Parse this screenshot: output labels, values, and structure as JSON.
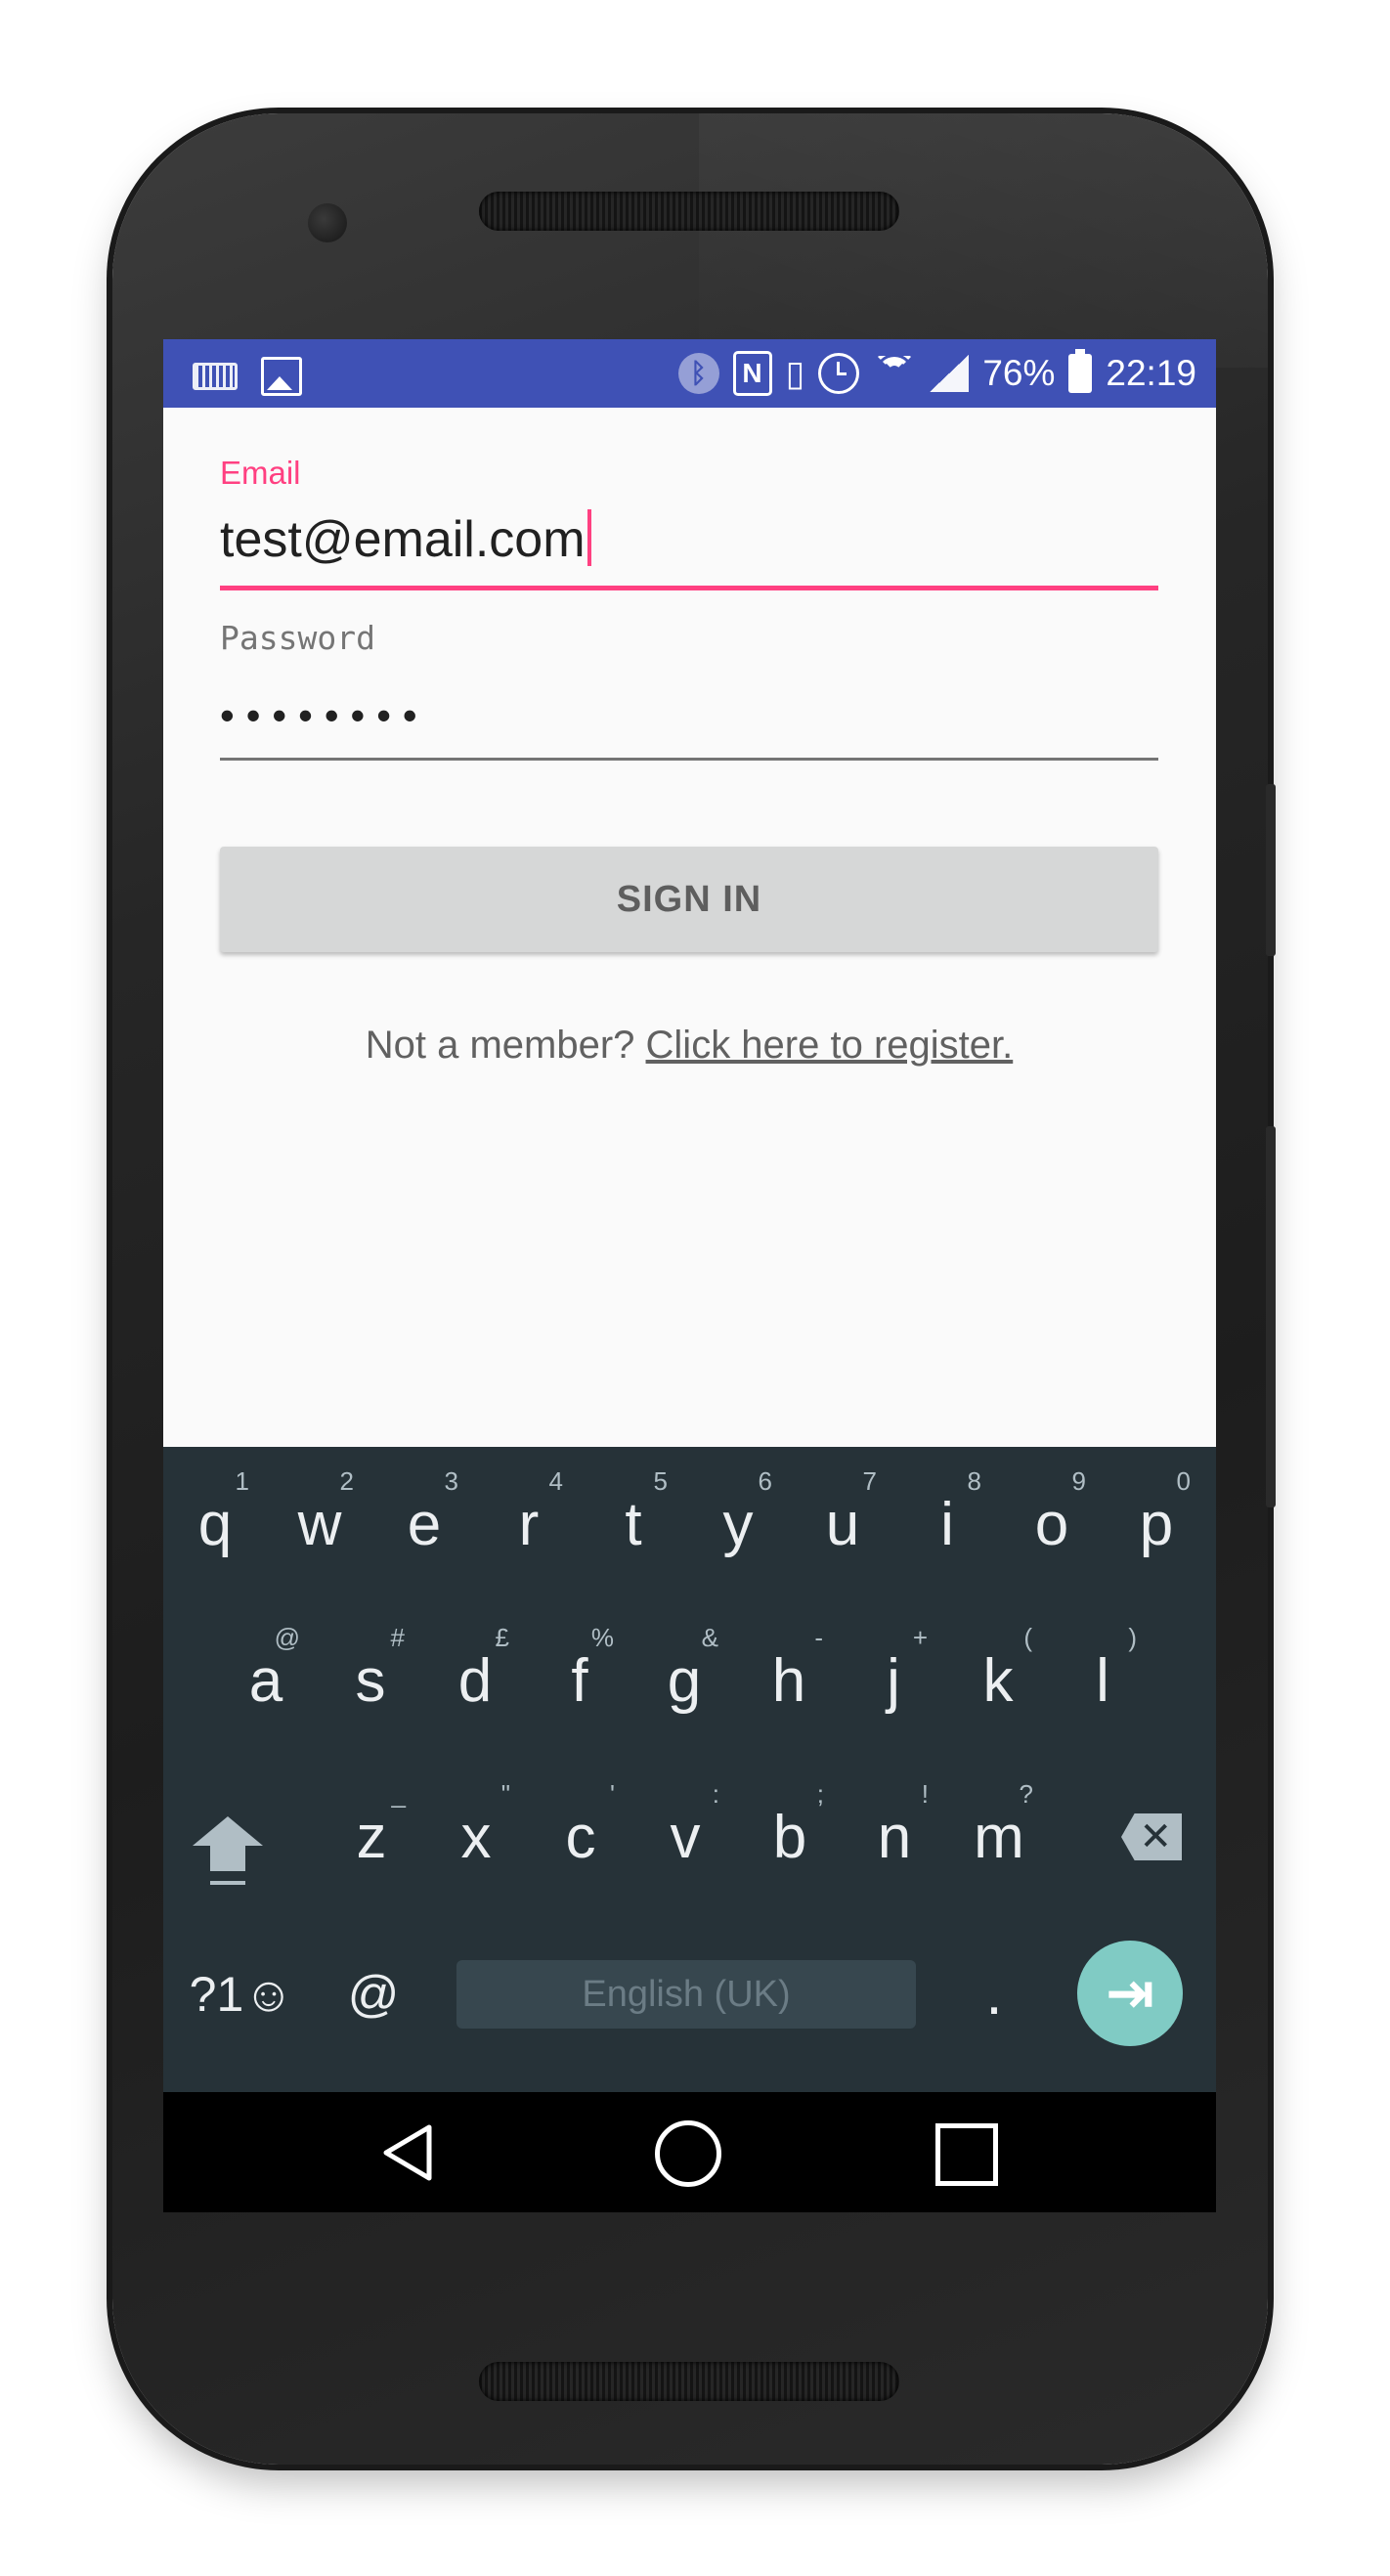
{
  "statusbar": {
    "battery": "76%",
    "time": "22:19",
    "left_icons": [
      "keyboard-icon",
      "image-icon"
    ],
    "right_icons": [
      "bluetooth-icon",
      "nfc-icon",
      "vibrate-icon",
      "alarm-icon",
      "wifi-icon",
      "signal-icon",
      "battery-icon"
    ]
  },
  "form": {
    "email_label": "Email",
    "email_value": "test@email.com",
    "password_hint": "Password",
    "password_value": "••••••••",
    "signin_label": "SIGN IN",
    "register_prefix": "Not a member? ",
    "register_link": "Click here to register."
  },
  "keyboard": {
    "row1": [
      {
        "k": "q",
        "h": "1"
      },
      {
        "k": "w",
        "h": "2"
      },
      {
        "k": "e",
        "h": "3"
      },
      {
        "k": "r",
        "h": "4"
      },
      {
        "k": "t",
        "h": "5"
      },
      {
        "k": "y",
        "h": "6"
      },
      {
        "k": "u",
        "h": "7"
      },
      {
        "k": "i",
        "h": "8"
      },
      {
        "k": "o",
        "h": "9"
      },
      {
        "k": "p",
        "h": "0"
      }
    ],
    "row2": [
      {
        "k": "a",
        "h": "@"
      },
      {
        "k": "s",
        "h": "#"
      },
      {
        "k": "d",
        "h": "£"
      },
      {
        "k": "f",
        "h": "%"
      },
      {
        "k": "g",
        "h": "&"
      },
      {
        "k": "h",
        "h": "-"
      },
      {
        "k": "j",
        "h": "+"
      },
      {
        "k": "k",
        "h": "("
      },
      {
        "k": "l",
        "h": ")"
      }
    ],
    "row3": [
      {
        "k": "z",
        "h": "_"
      },
      {
        "k": "x",
        "h": "\""
      },
      {
        "k": "c",
        "h": "'"
      },
      {
        "k": "v",
        "h": ":"
      },
      {
        "k": "b",
        "h": ";"
      },
      {
        "k": "n",
        "h": "!"
      },
      {
        "k": "m",
        "h": "?"
      }
    ],
    "symbols_label": "?1☺",
    "at_label": "@",
    "space_label": "English (UK)",
    "period_label": ".",
    "enter_glyph": "⇥",
    "delete_glyph": "✕"
  },
  "colors": {
    "accent": "#ff4081",
    "primary": "#3f51b5",
    "keyboard_bg": "#263238",
    "enter_key": "#80cbc4"
  }
}
